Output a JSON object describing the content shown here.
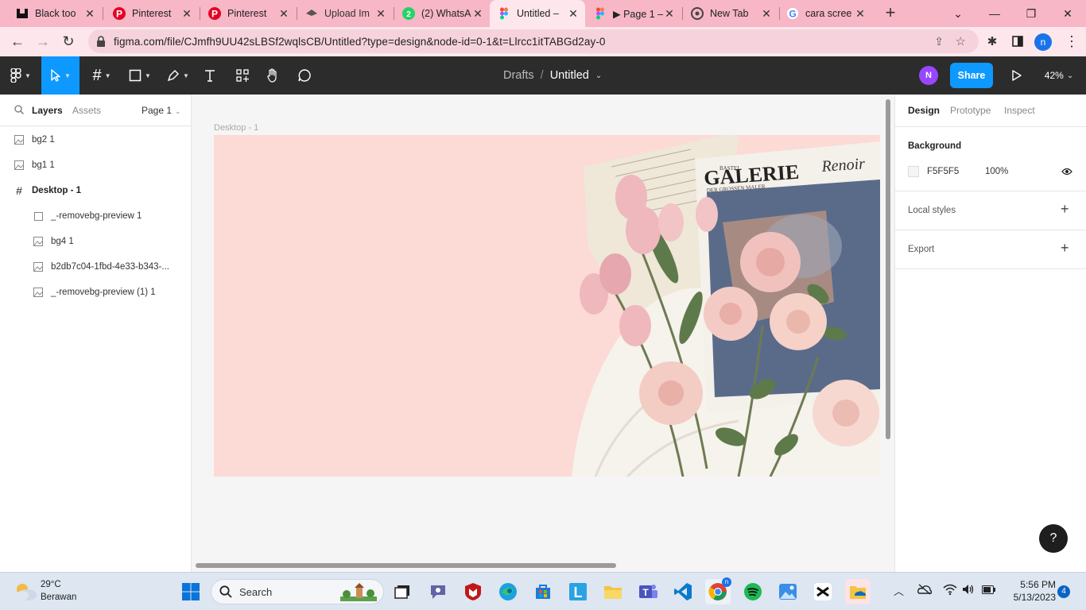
{
  "browser": {
    "tabs": [
      {
        "label": "Black too",
        "favicon": "black-tool-favicon",
        "active": false
      },
      {
        "label": "Pinterest",
        "favicon": "pinterest-favicon",
        "active": false
      },
      {
        "label": "Pinterest",
        "favicon": "pinterest-favicon",
        "active": false
      },
      {
        "label": "Upload Im",
        "favicon": "upload-favicon",
        "active": false
      },
      {
        "label": "(2) WhatsA",
        "favicon": "whatsapp-favicon",
        "active": false
      },
      {
        "label": "Untitled – ",
        "favicon": "figma-favicon",
        "active": true
      },
      {
        "label": "▶ Page 1 – ",
        "favicon": "figma-favicon",
        "active": false
      },
      {
        "label": "New Tab",
        "favicon": "chrome-favicon",
        "active": false
      },
      {
        "label": "cara scree",
        "favicon": "google-favicon",
        "active": false
      }
    ],
    "url": "figma.com/file/CJmfh9UU42sLBSf2wqlsCB/Untitled?type=design&node-id=0-1&t=Llrcc1itTABGd2ay-0",
    "profile_initial": "n"
  },
  "figma": {
    "breadcrumb_parent": "Drafts",
    "breadcrumb_sep": "/",
    "file_name": "Untitled",
    "user_initial": "N",
    "share_label": "Share",
    "zoom": "42%",
    "left": {
      "tab_layers": "Layers",
      "tab_assets": "Assets",
      "page": "Page 1",
      "layers": [
        {
          "name": "bg2 1",
          "icon": "image-icon",
          "indent": 0
        },
        {
          "name": "bg1 1",
          "icon": "image-icon",
          "indent": 0
        },
        {
          "name": "Desktop - 1",
          "icon": "frame-icon",
          "indent": 0
        },
        {
          "name": "_-removebg-preview 1",
          "icon": "rectangle-icon",
          "indent": 1
        },
        {
          "name": "bg4 1",
          "icon": "image-icon",
          "indent": 1
        },
        {
          "name": "b2db7c04-1fbd-4e33-b343-...",
          "icon": "image-icon",
          "indent": 1
        },
        {
          "name": "_-removebg-preview (1) 1",
          "icon": "image-icon",
          "indent": 1
        }
      ]
    },
    "canvas": {
      "frame_label": "Desktop - 1",
      "frame_color": "#FCDAD5",
      "book_title": "GALERIE",
      "book_small": "BASTEI",
      "book_sub": "DER GROSSEN MALER",
      "book_author": "Renoir"
    },
    "right": {
      "tabs": [
        "Design",
        "Prototype",
        "Inspect"
      ],
      "background_title": "Background",
      "background_hex": "F5F5F5",
      "background_opacity": "100%",
      "local_styles": "Local styles",
      "export": "Export",
      "help": "?"
    }
  },
  "taskbar": {
    "weather_temp": "29°C",
    "weather_desc": "Berawan",
    "search_placeholder": "Search",
    "time": "5:56 PM",
    "date": "5/13/2023",
    "notification_count": "4"
  }
}
